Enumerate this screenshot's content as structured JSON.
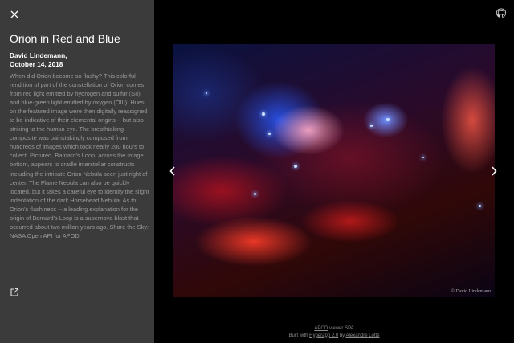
{
  "sidebar": {
    "close_icon": "close-icon",
    "title": "Orion in Red and Blue",
    "author": "David Lindemann,",
    "date": "October 14, 2018",
    "description": "When did Orion become so flashy? This colorful rendition of part of the constellation of Orion comes from red light emitted by hydrogen and sulfur (SII), and blue-green light emitted by oxygen (OIII). Hues on the featured image were then digitally reassigned to be indicative of their elemental origins -- but also striking to the human eye. The breathtaking composite was painstakingly composed from hundreds of images which took nearly 200 hours to collect. Pictured, Barnard's Loop, across the image bottom, appears to cradle interstellar constructs including the intricate Orion Nebula seen just right of center. The Flame Nebula can also be quickly located, but it takes a careful eye to identify the slight indentation of the dark Horsehead Nebula. As to Orion's flashiness -- a leading explanation for the origin of Barnard's Loop is a supernova blast that occurred about two million years ago. Share the Sky: NASA Open API for APOD",
    "external_link_icon": "external-link-icon"
  },
  "viewer": {
    "github_icon": "github-icon",
    "photo_watermark": "© David Lindemann",
    "prev_icon": "chevron-left-icon",
    "next_icon": "chevron-right-icon"
  },
  "footer": {
    "line1_link": "APOD",
    "line1_rest": " viewer SPA",
    "line2_prefix": "Built with ",
    "line2_framework": "Hyperapp 2.0",
    "line2_by": " by ",
    "line2_author": "Alexandre Lotte"
  },
  "colors": {
    "sidebar_bg": "#3b3b3b",
    "viewer_bg": "#000000",
    "description_text": "#9a9a9a",
    "footer_text": "#8a8a8a"
  }
}
